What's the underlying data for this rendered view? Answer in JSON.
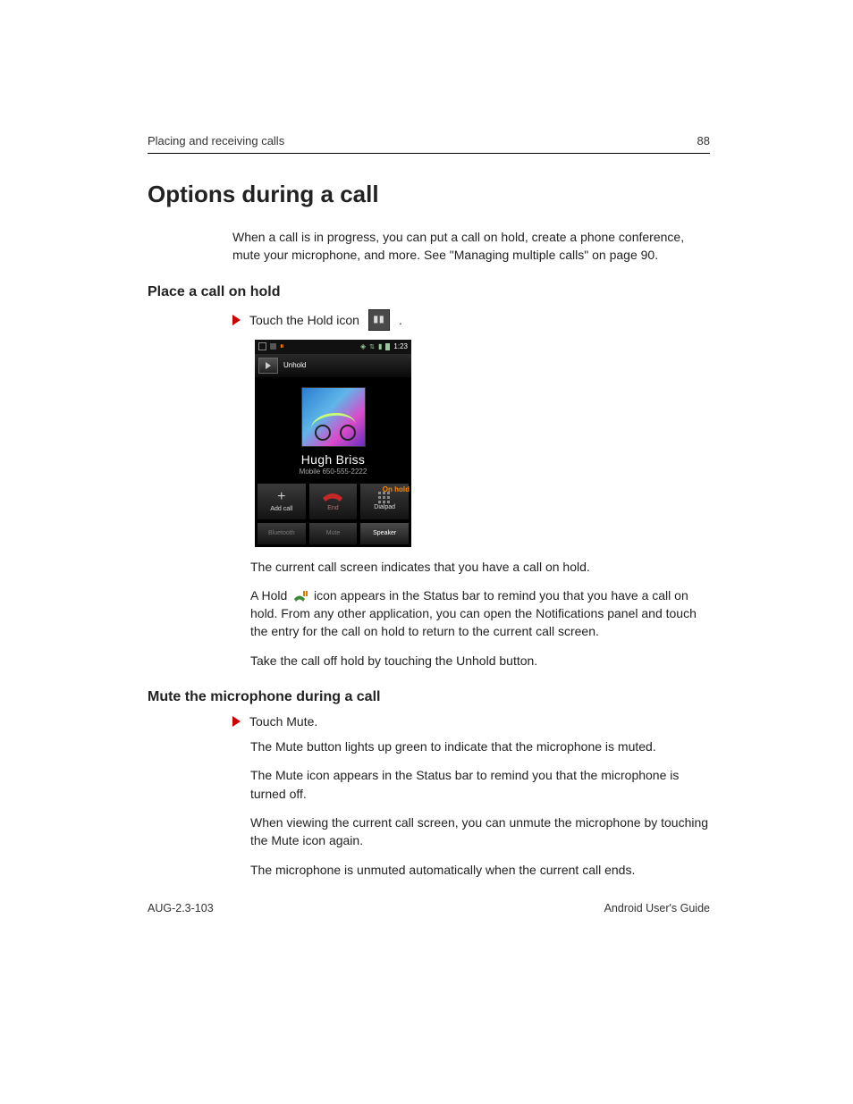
{
  "header": {
    "section": "Placing and receiving calls",
    "page": "88"
  },
  "title": "Options during a call",
  "intro": "When a call is in progress, you can put a call on hold, create a phone conference, mute your microphone, and more. See \"Managing multiple calls\" on page 90.",
  "section1": {
    "heading": "Place a call on hold",
    "step_text": "Touch the Hold icon",
    "step_after": ".",
    "para1": "The current call screen indicates that you have a call on hold.",
    "para2a": "A Hold",
    "para2b": "icon appears in the Status bar to remind you that you have a call on hold. From any other application, you can open the Notifications panel and touch the entry for the call on hold to return to the current call screen.",
    "para3": "Take the call off hold by touching the Unhold button."
  },
  "section2": {
    "heading": "Mute the microphone during a call",
    "step": "Touch Mute.",
    "p1": "The Mute button lights up green to indicate that the microphone is muted.",
    "p2": "The Mute icon appears in the Status bar to remind you that the microphone is turned off.",
    "p3": "When viewing the current call screen, you can unmute the microphone by touching the Mute icon again.",
    "p4": "The microphone is unmuted automatically when the current call ends."
  },
  "footer": {
    "left": "AUG-2.3-103",
    "right": "Android User's Guide"
  },
  "phone": {
    "time": "1:23",
    "unhold": "Unhold",
    "onhold": "On hold",
    "name": "Hugh Briss",
    "number_label": "Mobile",
    "number": "650-555-2222",
    "buttons": {
      "addcall": "Add call",
      "end": "End",
      "dialpad": "Dialpad",
      "bluetooth": "Bluetooth",
      "mute": "Mute",
      "speaker": "Speaker"
    }
  }
}
